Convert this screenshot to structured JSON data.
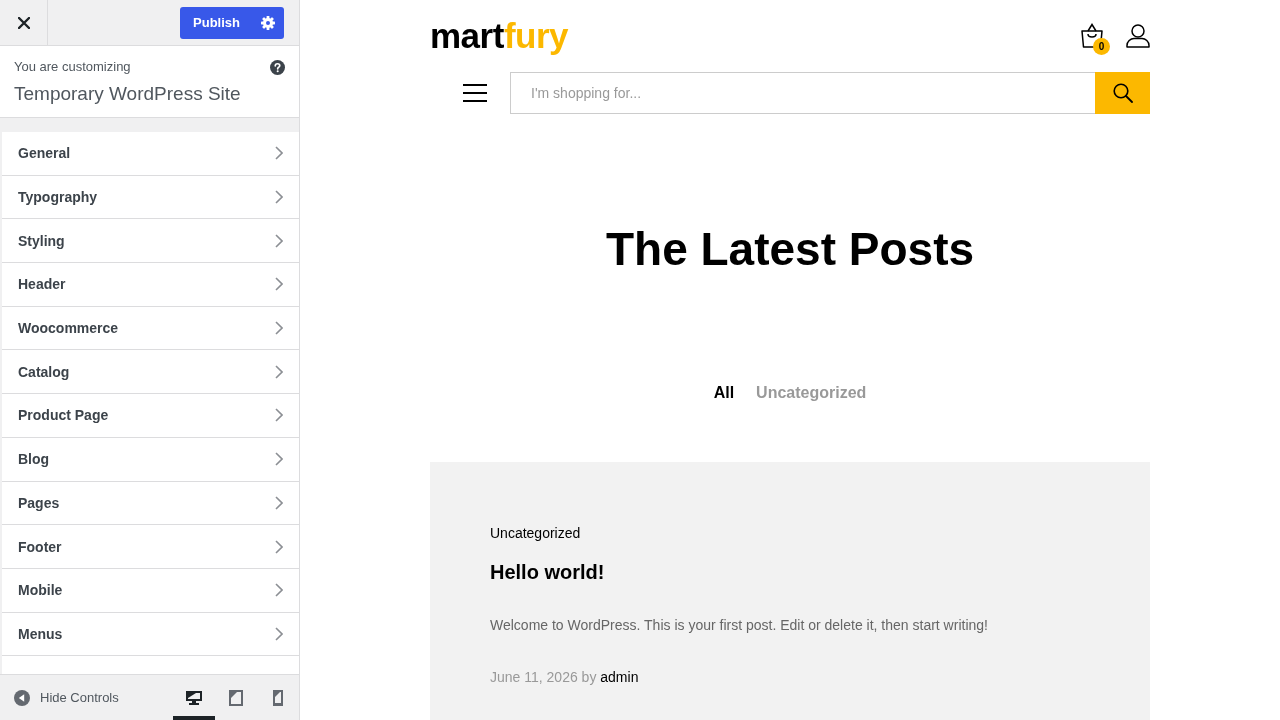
{
  "customizer": {
    "publish_label": "Publish",
    "info_label": "You are customizing",
    "site_title": "Temporary WordPress Site",
    "sections": [
      {
        "label": "General"
      },
      {
        "label": "Typography"
      },
      {
        "label": "Styling"
      },
      {
        "label": "Header"
      },
      {
        "label": "Woocommerce"
      },
      {
        "label": "Catalog"
      },
      {
        "label": "Product Page"
      },
      {
        "label": "Blog"
      },
      {
        "label": "Pages"
      },
      {
        "label": "Footer"
      },
      {
        "label": "Mobile"
      },
      {
        "label": "Menus"
      }
    ],
    "footer": {
      "hide_controls": "Hide Controls",
      "devices": [
        {
          "kind": "desktop",
          "selected": true
        },
        {
          "kind": "tablet",
          "selected": false
        },
        {
          "kind": "mobile",
          "selected": false
        }
      ]
    }
  },
  "preview": {
    "logo": {
      "part_1": "mart",
      "part_2": "fury"
    },
    "cart_count": "0",
    "search": {
      "placeholder": "I'm shopping for..."
    },
    "heading": "The Latest Posts",
    "filters": [
      {
        "label": "All",
        "selected": true
      },
      {
        "label": "Uncategorized",
        "selected": false
      }
    ],
    "posts": [
      {
        "category": "Uncategorized",
        "title": "Hello world!",
        "excerpt": "Welcome to WordPress. This is your first post. Edit or delete it, then start writing!",
        "date": "June 11, 2026",
        "by": "by",
        "author": "admin"
      }
    ]
  }
}
